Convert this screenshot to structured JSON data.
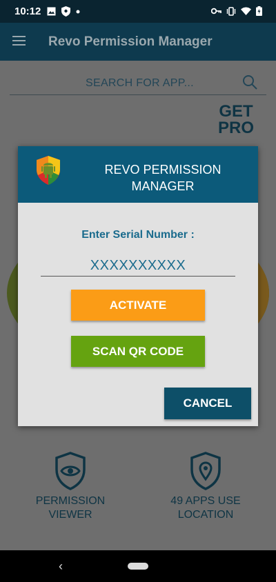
{
  "status_bar": {
    "time": "10:12",
    "left_icons": [
      "image-icon",
      "shield-icon",
      "dot-icon"
    ],
    "right_icons": [
      "key-icon",
      "vibrate-icon",
      "wifi-icon",
      "battery-icon"
    ]
  },
  "app_bar": {
    "title": "Revo Permission Manager",
    "menu_icon": "hamburger-icon"
  },
  "search": {
    "placeholder": "SEARCH FOR APP...",
    "icon": "search-icon"
  },
  "get_pro": {
    "line1": "GET",
    "line2": "PRO"
  },
  "features": [
    {
      "icon": "eye-shield-icon",
      "line1": "PERMISSION",
      "line2": "VIEWER"
    },
    {
      "icon": "location-shield-icon",
      "line1": "49 APPS USE",
      "line2": "LOCATION"
    }
  ],
  "dialog": {
    "title_line1": "REVO PERMISSION",
    "title_line2": "MANAGER",
    "serial_label": "Enter Serial Number :",
    "serial_value": "XXXXXXXXXX",
    "activate_label": "ACTIVATE",
    "scan_label": "SCAN QR CODE",
    "cancel_label": "CANCEL"
  },
  "colors": {
    "app_bar": "#0e3a4e",
    "dialog_header": "#0c5a7a",
    "activate": "#fb9c16",
    "scan": "#65a310",
    "cancel": "#0d4f68",
    "accent_text": "#1a6b8d"
  }
}
